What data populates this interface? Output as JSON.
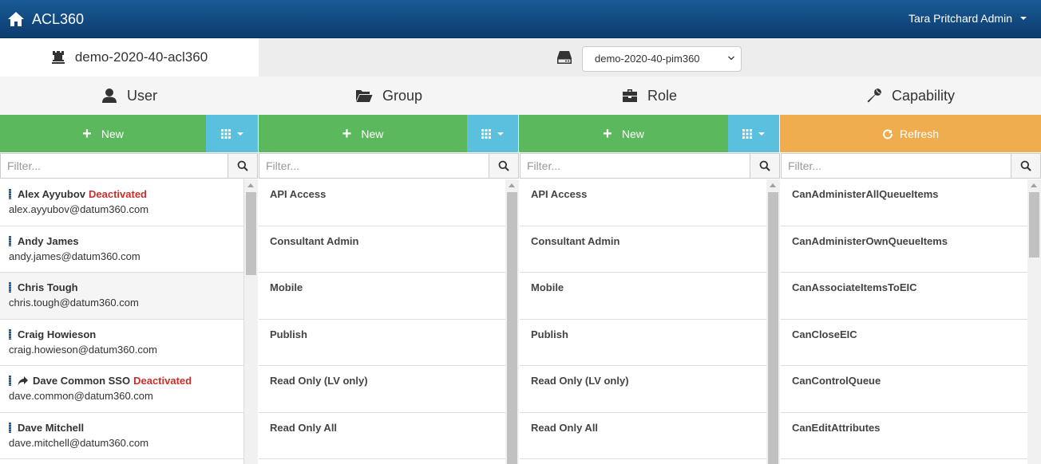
{
  "navbar": {
    "app_title": "ACL360",
    "user_label": "Tara Pritchard Admin",
    "icons": {
      "home": "home-icon",
      "caret": "caret-down-icon"
    }
  },
  "server": {
    "acl_name": "demo-2020-40-acl360",
    "db_selected": "demo-2020-40-pim360",
    "icons": {
      "acl": "chess-rook-icon",
      "db": "hard-drive-icon"
    }
  },
  "columns": {
    "user": {
      "header": "User",
      "new_label": "New",
      "filter_placeholder": "Filter...",
      "icon": "user-icon"
    },
    "group": {
      "header": "Group",
      "new_label": "New",
      "filter_placeholder": "Filter...",
      "icon": "folder-open-icon"
    },
    "role": {
      "header": "Role",
      "new_label": "New",
      "filter_placeholder": "Filter...",
      "icon": "briefcase-icon"
    },
    "capability": {
      "header": "Capability",
      "refresh_label": "Refresh",
      "filter_placeholder": "Filter...",
      "icon": "wrench-icon"
    }
  },
  "colors": {
    "green": "#5cb85c",
    "blue": "#5bc0de",
    "orange": "#f0ad4e",
    "navbar": "#0b3c6e",
    "deactivated": "#c9302c"
  },
  "users": [
    {
      "name": "Alex Ayyubov",
      "status": "Deactivated",
      "email": "alex.ayyubov@datum360.com"
    },
    {
      "name": "Andy James",
      "status": "",
      "email": "andy.james@datum360.com"
    },
    {
      "name": "Chris Tough",
      "status": "",
      "email": "chris.tough@datum360.com"
    },
    {
      "name": "Craig Howieson",
      "status": "",
      "email": "craig.howieson@datum360.com"
    },
    {
      "name": "Dave Common SSO",
      "status": "Deactivated",
      "email": "dave.common@datum360.com"
    },
    {
      "name": "Dave Mitchell",
      "status": "",
      "email": "dave.mitchell@datum360.com"
    }
  ],
  "groups": [
    "API Access",
    "Consultant Admin",
    "Mobile",
    "Publish",
    "Read Only (LV only)",
    "Read Only All"
  ],
  "roles": [
    "API Access",
    "Consultant Admin",
    "Mobile",
    "Publish",
    "Read Only (LV only)",
    "Read Only All"
  ],
  "capabilities": [
    "CanAdministerAllQueueItems",
    "CanAdministerOwnQueueItems",
    "CanAssociateItemsToEIC",
    "CanCloseEIC",
    "CanControlQueue",
    "CanEditAttributes"
  ]
}
